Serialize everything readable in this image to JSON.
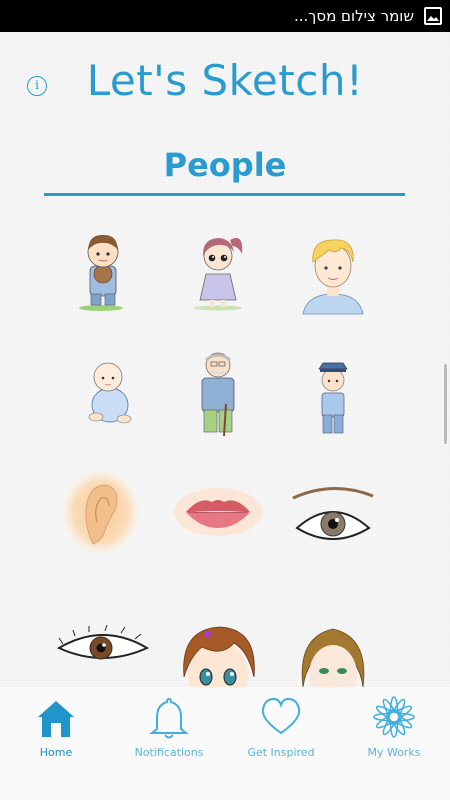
{
  "status_bar": {
    "text": "שומר צילום מסך...",
    "icon": "image-icon"
  },
  "header": {
    "title": "Let's Sketch!",
    "info_icon": "i"
  },
  "category": {
    "title": "People"
  },
  "sketches": [
    {
      "name": "Boy with monkey"
    },
    {
      "name": "Girl with ponytail"
    },
    {
      "name": "Blond boy"
    },
    {
      "name": "Baby"
    },
    {
      "name": "Grandpa"
    },
    {
      "name": "Police boy"
    },
    {
      "name": "Ear"
    },
    {
      "name": "Lips"
    },
    {
      "name": "Eye with brow"
    },
    {
      "name": "Eye"
    },
    {
      "name": "Anime girl"
    },
    {
      "name": "Woman face"
    }
  ],
  "nav": {
    "items": [
      {
        "label": "Home",
        "icon": "home-icon",
        "active": true
      },
      {
        "label": "Notifications",
        "icon": "bell-icon",
        "active": false
      },
      {
        "label": "Get Inspired",
        "icon": "heart-icon",
        "active": false
      },
      {
        "label": "My Works",
        "icon": "flower-icon",
        "active": false
      }
    ]
  },
  "colors": {
    "accent": "#2a9bd0",
    "nav_active": "#1a8cc7"
  }
}
